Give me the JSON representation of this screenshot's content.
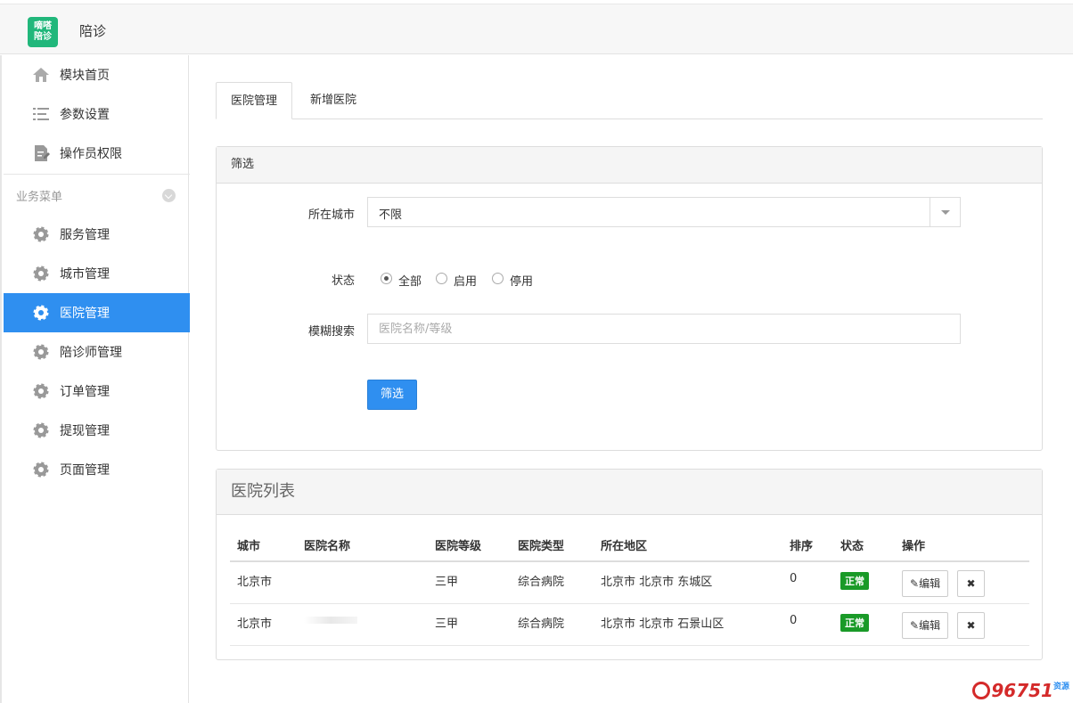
{
  "app": {
    "logo_line1": "嘀嗒",
    "logo_line2": "陪诊",
    "title": "陪诊"
  },
  "sidebar": {
    "top_items": [
      {
        "label": "模块首页",
        "icon": "home-icon"
      },
      {
        "label": "参数设置",
        "icon": "list-settings-icon"
      },
      {
        "label": "操作员权限",
        "icon": "document-edit-icon"
      }
    ],
    "section_label": "业务菜单",
    "items": [
      {
        "label": "服务管理",
        "icon": "gear-icon"
      },
      {
        "label": "城市管理",
        "icon": "gear-icon"
      },
      {
        "label": "医院管理",
        "icon": "gear-icon",
        "active": true
      },
      {
        "label": "陪诊师管理",
        "icon": "gear-icon"
      },
      {
        "label": "订单管理",
        "icon": "gear-icon"
      },
      {
        "label": "提现管理",
        "icon": "gear-icon"
      },
      {
        "label": "页面管理",
        "icon": "gear-icon"
      }
    ]
  },
  "tabs": [
    {
      "label": "医院管理",
      "active": true
    },
    {
      "label": "新增医院",
      "active": false
    }
  ],
  "filter": {
    "title": "筛选",
    "city_label": "所在城市",
    "city_value": "不限",
    "status_label": "状态",
    "status_options": [
      {
        "label": "全部",
        "checked": true
      },
      {
        "label": "启用",
        "checked": false
      },
      {
        "label": "停用",
        "checked": false
      }
    ],
    "search_label": "模糊搜索",
    "search_placeholder": "医院名称/等级",
    "search_value": "",
    "submit_label": "筛选"
  },
  "list": {
    "title": "医院列表",
    "columns": [
      "城市",
      "医院名称",
      "医院等级",
      "医院类型",
      "所在地区",
      "排序",
      "状态",
      "操作"
    ],
    "rows": [
      {
        "city": "北京市",
        "name": "",
        "level": "三甲",
        "type": "综合病院",
        "region": "北京市 北京市 东城区",
        "sort": "0",
        "status": "正常",
        "edit_label": "编辑",
        "delete_label": "✖"
      },
      {
        "city": "北京市",
        "name": "",
        "level": "三甲",
        "type": "综合病院",
        "region": "北京市 北京市 石景山区",
        "sort": "0",
        "status": "正常",
        "edit_label": "编辑",
        "delete_label": "✖"
      }
    ]
  },
  "colors": {
    "accent": "#2f8ff0",
    "logo_bg": "#21b77b",
    "status_ok": "#1a9a28"
  },
  "watermark": {
    "text": "96751",
    "suffix": "资源"
  }
}
